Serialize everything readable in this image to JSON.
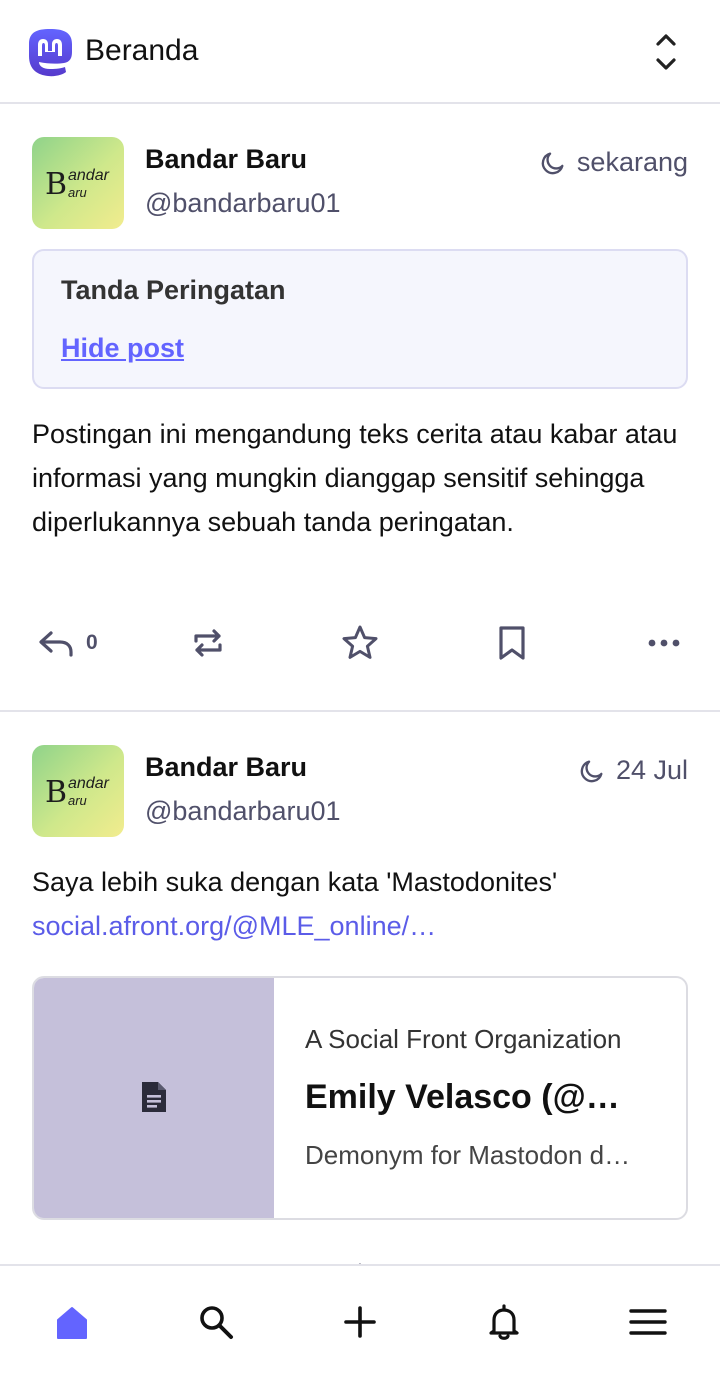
{
  "header": {
    "title": "Beranda",
    "logo_icon": "mastodon-logo-icon",
    "toggle_icon": "chevron-up-down-icon"
  },
  "posts": [
    {
      "display_name": "Bandar Baru",
      "handle": "@bandarbaru01",
      "timestamp": "sekarang",
      "visibility_icon": "moon-icon",
      "avatar": {
        "big": "B",
        "top": "andar",
        "bottom": "aru"
      },
      "content_warning": {
        "title": "Tanda Peringatan",
        "toggle_label": "Hide post"
      },
      "text": "Postingan ini mengandung teks cerita atau kabar atau informasi yang mungkin dianggap sensitif sehingga diperlukannya sebuah tanda peringatan.",
      "reply_count": "0"
    },
    {
      "display_name": "Bandar Baru",
      "handle": "@bandarbaru01",
      "timestamp": "24 Jul",
      "visibility_icon": "moon-icon",
      "avatar": {
        "big": "B",
        "top": "andar",
        "bottom": "aru"
      },
      "text": "Saya lebih suka dengan kata 'Mastodonites'",
      "link": "social.afront.org/@MLE_online/…",
      "card": {
        "provider": "A Social Front Organization",
        "title": "Emily Velasco (@…",
        "description": "Demonym for Mastodon d…",
        "thumb_icon": "document-icon"
      }
    }
  ],
  "nav": {
    "items": [
      "home-icon",
      "search-icon",
      "plus-icon",
      "bell-icon",
      "menu-icon"
    ],
    "active_color": "#6364ff"
  },
  "colors": {
    "accent": "#6364ff",
    "text_secondary": "#50506a"
  }
}
